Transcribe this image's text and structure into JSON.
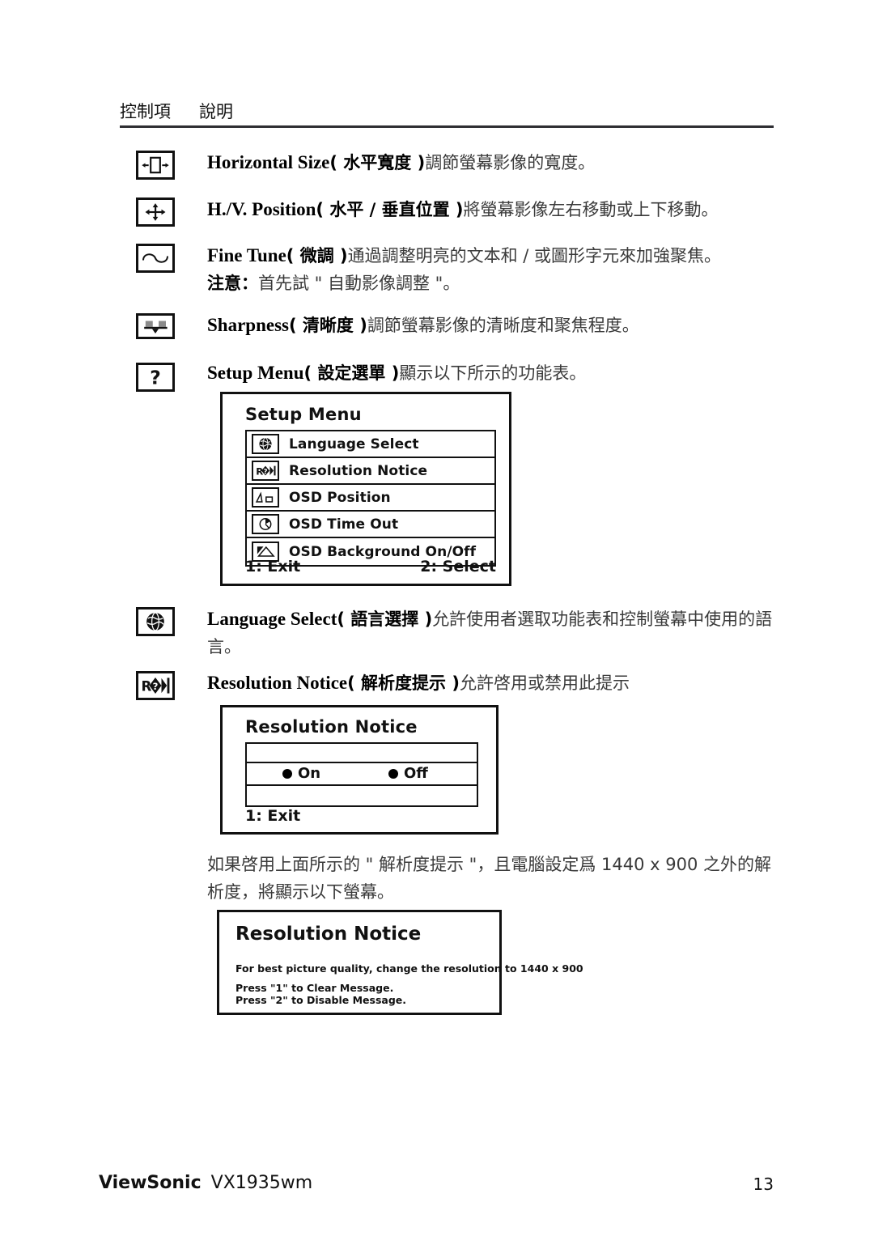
{
  "header": {
    "col_control": "控制項",
    "col_description": "說明"
  },
  "entries": [
    {
      "icon": "horizontal-size-icon",
      "title_en": "Horizontal Size",
      "title_zh": "( 水平寬度 )",
      "body": "調節螢幕影像的寬度。"
    },
    {
      "icon": "hv-position-icon",
      "title_en": "H./V. Position",
      "title_zh": "( 水平 / 垂直位置 )",
      "body": "將螢幕影像左右移動或上下移動。"
    },
    {
      "icon": "fine-tune-icon",
      "title_en": "Fine Tune",
      "title_zh": "( 微調 )",
      "body": "通過調整明亮的文本和 / 或圖形字元來加強聚焦。",
      "note_label": "注意：",
      "note_body": "首先試 \" 自動影像調整 \"。"
    },
    {
      "icon": "sharpness-icon",
      "title_en": "Sharpness",
      "title_zh": "( 清晰度 )",
      "body": "調節螢幕影像的清晰度和聚焦程度。"
    },
    {
      "icon": "setup-menu-icon",
      "title_en": "Setup Menu",
      "title_zh": "( 設定選單 )",
      "body": "顯示以下所示的功能表。"
    },
    {
      "icon": "language-select-icon",
      "title_en": "Language Select",
      "title_zh": "( 語言選擇 )",
      "body": "允許使用者選取功能表和控制螢幕中使用的語言。"
    },
    {
      "icon": "resolution-notice-icon",
      "title_en": "Resolution Notice",
      "title_zh": "( 解析度提示 )",
      "body": "允許啓用或禁用此提示"
    }
  ],
  "setup_menu_osd": {
    "title": "Setup Menu",
    "items": [
      {
        "icon": "globe-icon",
        "label": "Language Select"
      },
      {
        "icon": "resolution-notice-icon",
        "label": "Resolution Notice"
      },
      {
        "icon": "osd-position-icon",
        "label": "OSD Position"
      },
      {
        "icon": "osd-timeout-icon",
        "label": "OSD Time Out"
      },
      {
        "icon": "osd-background-icon",
        "label": "OSD Background On/Off"
      }
    ],
    "footer_left": "1: Exit",
    "footer_right": "2: Select"
  },
  "resolution_notice_osd": {
    "title": "Resolution Notice",
    "option_on": "On",
    "option_off": "Off",
    "footer_left": "1: Exit"
  },
  "resolution_paragraph": "如果啓用上面所示的 \" 解析度提示 \"，且電腦設定爲 1440 x 900 之外的解析度，將顯示以下螢幕。",
  "resolution_message_box": {
    "title": "Resolution Notice",
    "line1": "For best picture quality, change the resolution to 1440 x 900",
    "line2": "Press \"1\" to Clear Message.",
    "line3": "Press \"2\" to Disable Message."
  },
  "footer": {
    "brand": "ViewSonic",
    "model": "VX1935wm",
    "page_number": "13"
  }
}
